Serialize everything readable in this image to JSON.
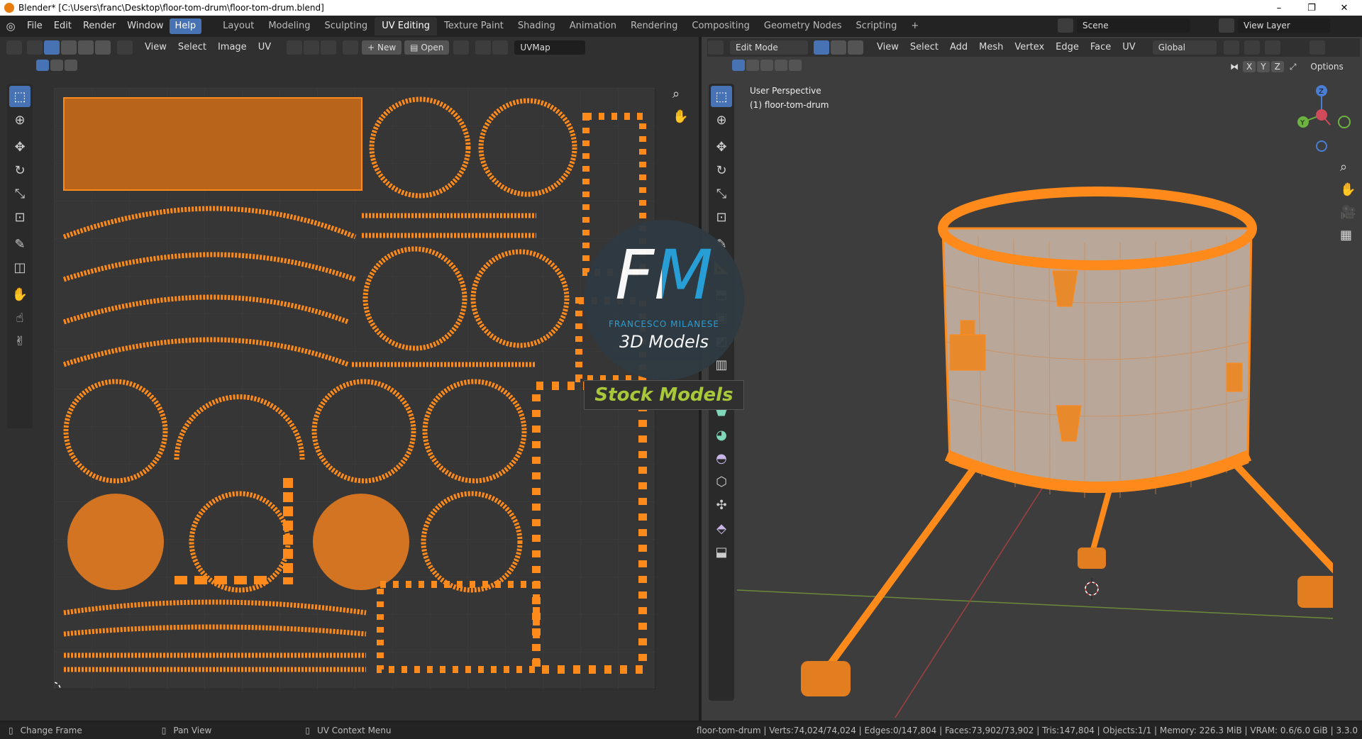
{
  "window": {
    "title": "Blender* [C:\\Users\\franc\\Desktop\\floor-tom-drum\\floor-tom-drum.blend]",
    "minimize": "–",
    "restore": "❐",
    "close": "✕"
  },
  "menu": [
    "File",
    "Edit",
    "Render",
    "Window",
    "Help"
  ],
  "workspaces": [
    "Layout",
    "Modeling",
    "Sculpting",
    "UV Editing",
    "Texture Paint",
    "Shading",
    "Animation",
    "Rendering",
    "Compositing",
    "Geometry Nodes",
    "Scripting",
    "+"
  ],
  "scene": {
    "label": "Scene",
    "view_layer": "View Layer"
  },
  "uv_editor": {
    "menus": [
      "View",
      "Select",
      "Image",
      "UV"
    ],
    "new_label": "New",
    "open_label": "Open",
    "uvmap": "UVMap"
  },
  "viewport": {
    "mode": "Edit Mode",
    "menus": [
      "View",
      "Select",
      "Add",
      "Mesh",
      "Vertex",
      "Edge",
      "Face",
      "UV"
    ],
    "orientation": "Global",
    "options": "Options",
    "perspective": "User Perspective",
    "object": "(1) floor-tom-drum",
    "axes": {
      "x": "X",
      "y": "Y",
      "z": "Z"
    }
  },
  "watermark": {
    "logo": "FM",
    "brand": "FRANCESCO MILANESE",
    "subtitle": "3D Models",
    "banner": "Stock Models"
  },
  "status": {
    "change_frame": "Change Frame",
    "pan_view": "Pan View",
    "context_menu": "UV Context Menu",
    "stats": "floor-tom-drum | Verts:74,024/74,024 | Edges:0/147,804 | Faces:73,902/73,902 | Tris:147,804 | Objects:1/1 | Memory: 226.3 MiB | VRAM: 0.6/6.0 GiB | 3.3.0"
  },
  "colors": {
    "accent": "#4772b3",
    "uv_orange": "#ff8a1c",
    "panel": "#303030"
  }
}
